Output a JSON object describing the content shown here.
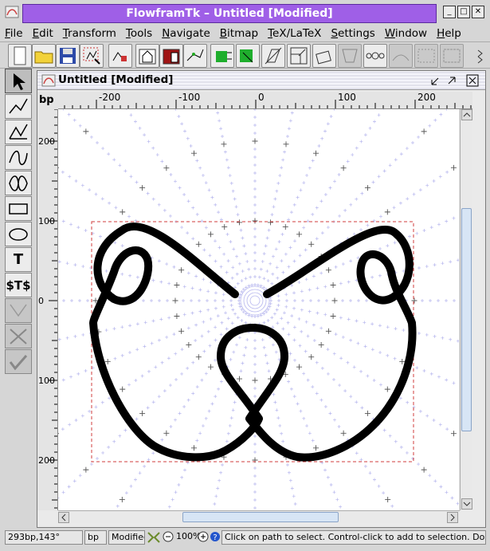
{
  "app": {
    "title": "FlowframTk – Untitled [Modified]",
    "window_buttons": [
      "_",
      "□",
      "✕"
    ]
  },
  "menu": [
    {
      "label": "File",
      "name": "menu-file"
    },
    {
      "label": "Edit",
      "name": "menu-edit"
    },
    {
      "label": "Transform",
      "name": "menu-transform"
    },
    {
      "label": "Tools",
      "name": "menu-tools"
    },
    {
      "label": "Navigate",
      "name": "menu-navigate"
    },
    {
      "label": "Bitmap",
      "name": "menu-bitmap"
    },
    {
      "label": "TeX/LaTeX",
      "name": "menu-tex-latex"
    },
    {
      "label": "Settings",
      "name": "menu-settings"
    },
    {
      "label": "Window",
      "name": "menu-window"
    },
    {
      "label": "Help",
      "name": "menu-help"
    }
  ],
  "document": {
    "title": "Untitled [Modified]",
    "unit_label": "bp"
  },
  "rulers": {
    "top_ticks": [
      "-200",
      "-100",
      "0",
      "100",
      "200"
    ],
    "left_ticks": [
      "200",
      "100",
      "0",
      "100",
      "200"
    ]
  },
  "left_tools": {
    "text_tool_label": "T",
    "math_tool_label": "$T$"
  },
  "status": {
    "position": "293bp,143°",
    "unit": "bp",
    "modified": "Modified",
    "zoom": "100%",
    "help": "Click on path to select. Control-click to add to selection. Double click"
  },
  "colors": {
    "title_accent": "#9f5fe7",
    "grid": "#b6b6ee",
    "bbox": "#d23c3c",
    "path": "#000000"
  }
}
